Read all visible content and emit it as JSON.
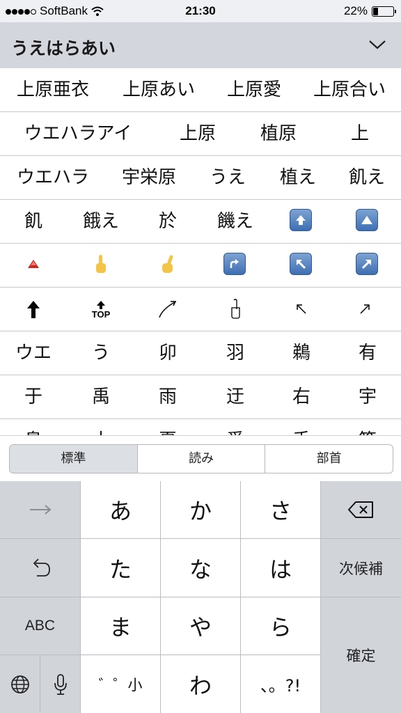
{
  "status_bar": {
    "carrier": "SoftBank",
    "time": "21:30",
    "battery": "22%"
  },
  "reading": {
    "text": "うえはらあい"
  },
  "candidates": {
    "row1": [
      "上原亜衣",
      "上原あい",
      "上原愛",
      "上原合い"
    ],
    "row2": [
      "ウエハラアイ",
      "上原",
      "植原",
      "上"
    ],
    "row3": [
      "ウエハラ",
      "宇栄原",
      "うえ",
      "植え",
      "飢え"
    ],
    "row4": [
      "飢",
      "餓え",
      "於",
      "饑え"
    ],
    "row5_emoji": [
      "up-red-triangle",
      "pointing-up-hand",
      "index-pointing-up-hand",
      "arrow-right-curving-up",
      "arrow-up-left",
      "arrow-up-right"
    ],
    "row6": [
      "up-arrow",
      "top-arrow",
      "curve-up-arrow",
      "hand-pointing-up",
      "arrow-up-left-thin",
      "arrow-up-right-thin"
    ],
    "row6_top_text": "TOP",
    "row7": [
      "ウエ",
      "う",
      "卯",
      "羽",
      "鵜",
      "有"
    ],
    "row8": [
      "于",
      "禹",
      "雨",
      "迂",
      "右",
      "宇"
    ],
    "row9": [
      "鳥",
      "木",
      "夏",
      "愛",
      "手",
      "等"
    ]
  },
  "segmented": {
    "standard": "標準",
    "reading": "読み",
    "radical": "部首"
  },
  "keyboard": {
    "a": "あ",
    "ka": "か",
    "sa": "さ",
    "ta": "た",
    "na": "な",
    "ha": "は",
    "ma": "ま",
    "ya": "や",
    "ra": "ら",
    "dakuten": "゛゜小",
    "wa": "わ",
    "punct": "、。?!",
    "next_candidate": "次候補",
    "confirm": "確定",
    "abc": "ABC",
    "icons": [
      "arrow-right-icon",
      "undo-icon",
      "globe-icon",
      "mic-icon",
      "delete-icon"
    ]
  }
}
